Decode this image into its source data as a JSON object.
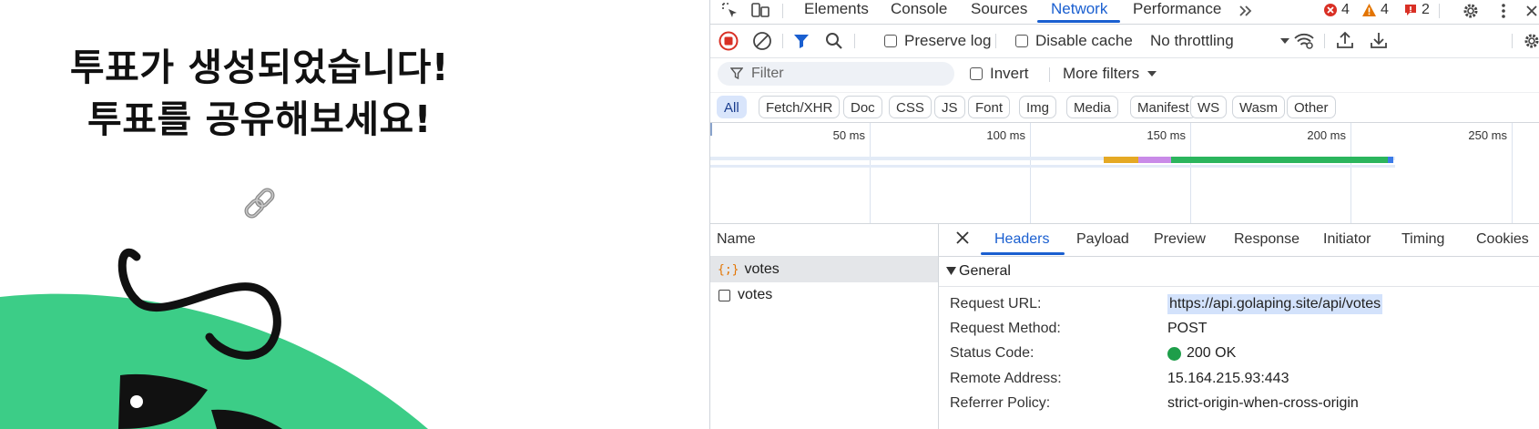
{
  "page": {
    "title_line1": "투표가 생성되었습니다!",
    "title_line2": "투표를 공유해보세요!",
    "link_icon": "link-icon",
    "colors": {
      "mascot_green": "#3ccd87",
      "ink": "#111111"
    }
  },
  "devtools": {
    "tabs": [
      "Elements",
      "Console",
      "Sources",
      "Network",
      "Performance"
    ],
    "active_tab": "Network",
    "more_tabs_icon": "double-chevron-right-icon",
    "counts": {
      "errors": "4",
      "warnings": "4",
      "issues": "2"
    },
    "toolbar": {
      "preserve_log": "Preserve log",
      "disable_cache": "Disable cache",
      "throttling": "No throttling"
    },
    "filter": {
      "placeholder": "Filter",
      "invert": "Invert",
      "more_filters": "More filters"
    },
    "types": [
      "All",
      "Fetch/XHR",
      "Doc",
      "CSS",
      "JS",
      "Font",
      "Img",
      "Media",
      "Manifest",
      "WS",
      "Wasm",
      "Other"
    ],
    "active_type": "All",
    "timeline_ticks": [
      "50 ms",
      "100 ms",
      "150 ms",
      "200 ms",
      "250 ms"
    ],
    "name_column": "Name",
    "requests": [
      {
        "name": "votes",
        "icon": "fetch-icon",
        "selected": true
      },
      {
        "name": "votes",
        "icon": "document-icon",
        "selected": false
      }
    ],
    "detail_tabs": [
      "Headers",
      "Payload",
      "Preview",
      "Response",
      "Initiator",
      "Timing",
      "Cookies"
    ],
    "active_detail_tab": "Headers",
    "general": {
      "section_title": "General",
      "rows": [
        {
          "key": "Request URL:",
          "value": "https://api.golaping.site/api/votes"
        },
        {
          "key": "Request Method:",
          "value": "POST"
        },
        {
          "key": "Status Code:",
          "value": "200 OK"
        },
        {
          "key": "Remote Address:",
          "value": "15.164.215.93:443"
        },
        {
          "key": "Referrer Policy:",
          "value": "strict-origin-when-cross-origin"
        }
      ]
    },
    "colors": {
      "accent": "#1a5fd0",
      "status_ok": "#1e9e4a",
      "error": "#d93025",
      "warning": "#e37400",
      "record": "#d93025"
    }
  }
}
